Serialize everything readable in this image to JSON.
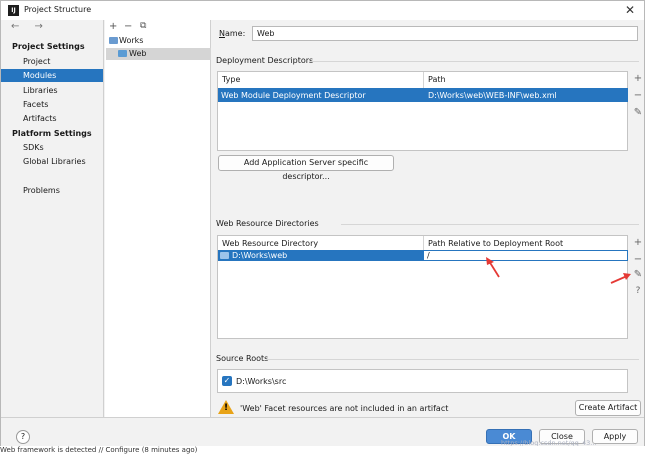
{
  "window": {
    "title": "Project Structure",
    "app_icon": "IJ"
  },
  "nav": {
    "arrows": "← →",
    "project_settings_header": "Project Settings",
    "items_project": [
      "Project",
      "Modules",
      "Libraries",
      "Facets",
      "Artifacts"
    ],
    "platform_settings_header": "Platform Settings",
    "items_platform": [
      "SDKs",
      "Global Libraries"
    ],
    "problems": "Problems",
    "selected": "Modules"
  },
  "tree": {
    "tools": [
      "+",
      "−",
      "⧉"
    ],
    "root": "Works",
    "child": "Web"
  },
  "name_field": {
    "label_prefix": "N",
    "label_rest": "ame:",
    "value": "Web"
  },
  "deployment": {
    "title": "Deployment Descriptors",
    "columns": [
      "Type",
      "Path"
    ],
    "row": {
      "type": "Web Module Deployment Descriptor",
      "path": "D:\\Works\\web\\WEB-INF\\web.xml"
    },
    "add_button": "Add Application Server specific descriptor..."
  },
  "web_resources": {
    "title": "Web Resource Directories",
    "columns": [
      "Web Resource Directory",
      "Path Relative to Deployment Root"
    ],
    "row": {
      "dir": "D:\\Works\\web",
      "path": "/"
    }
  },
  "source_roots": {
    "title": "Source Roots",
    "item": "D:\\Works\\src",
    "checked": true
  },
  "warning": {
    "text": "'Web' Facet resources are not included in an artifact",
    "button": "Create Artifact"
  },
  "footer": {
    "help": "?",
    "ok": "OK",
    "close": "Close",
    "apply": "Apply"
  },
  "statusbar": {
    "text": "Web framework is detected // Configure (8 minutes ago)"
  },
  "watermark": "https://blog.csdn.net/qq_43..."
}
